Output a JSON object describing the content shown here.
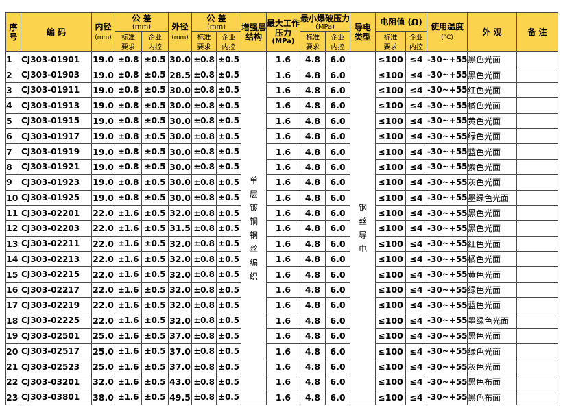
{
  "header": {
    "seq": [
      "序",
      "号"
    ],
    "code": "编 码",
    "inner_dia": "内径",
    "inner_unit": "(mm)",
    "tol1": "公 差",
    "tol1_unit": "(mm)",
    "outer_dia": "外径",
    "outer_unit": "(mm)",
    "tol2": "公 差",
    "tol2_unit": "(mm)",
    "reinf": [
      "增强层",
      "结构"
    ],
    "wp": "最大工作",
    "wp2": "压力",
    "wp_unit": "(MPa)",
    "burst": "最小爆破压力",
    "burst_unit": "(MPa)",
    "conduct": [
      "导电",
      "类型"
    ],
    "resist": "电阻值 (Ω)",
    "temp": "使用温度",
    "temp_unit": "(°C)",
    "look": "外 观",
    "note": "备 注",
    "std": [
      "标准",
      "要求"
    ],
    "ent": [
      "企业",
      "内控"
    ]
  },
  "merged": {
    "reinforcement": [
      "单",
      "层",
      "镀",
      "铜",
      "钢",
      "丝",
      "编",
      "织"
    ],
    "conduct_type": [
      "钢",
      "丝",
      "导",
      "电"
    ]
  },
  "rows": [
    {
      "seq": "1",
      "code": "CJ303-01901",
      "id": "19.0",
      "tol_std": "±0.8",
      "tol_ent": "±0.5",
      "od": "30.0",
      "od_std": "±0.8",
      "od_ent": "±0.5",
      "wp": "1.6",
      "burst_std": "4.8",
      "burst_ent": "6.0",
      "res_std": "≤100",
      "res_ent": "≤4",
      "temp": "-30~+55",
      "look": "黑色光面"
    },
    {
      "seq": "2",
      "code": "CJ303-01903",
      "id": "19.0",
      "tol_std": "±0.8",
      "tol_ent": "±0.5",
      "od": "28.5",
      "od_std": "±0.8",
      "od_ent": "±0.5",
      "wp": "1.6",
      "burst_std": "4.8",
      "burst_ent": "6.0",
      "res_std": "≤100",
      "res_ent": "≤4",
      "temp": "-30~+55",
      "look": "黑色光面"
    },
    {
      "seq": "3",
      "code": "CJ303-01911",
      "id": "19.0",
      "tol_std": "±0.8",
      "tol_ent": "±0.5",
      "od": "30.0",
      "od_std": "±0.8",
      "od_ent": "±0.5",
      "wp": "1.6",
      "burst_std": "4.8",
      "burst_ent": "6.0",
      "res_std": "≤100",
      "res_ent": "≤4",
      "temp": "-30~+55",
      "look": "红色光面"
    },
    {
      "seq": "4",
      "code": "CJ303-01913",
      "id": "19.0",
      "tol_std": "±0.8",
      "tol_ent": "±0.5",
      "od": "30.0",
      "od_std": "±0.8",
      "od_ent": "±0.5",
      "wp": "1.6",
      "burst_std": "4.8",
      "burst_ent": "6.0",
      "res_std": "≤100",
      "res_ent": "≤4",
      "temp": "-30~+55",
      "look": "橘色光面"
    },
    {
      "seq": "5",
      "code": "CJ303-01915",
      "id": "19.0",
      "tol_std": "±0.8",
      "tol_ent": "±0.5",
      "od": "30.0",
      "od_std": "±0.8",
      "od_ent": "±0.5",
      "wp": "1.6",
      "burst_std": "4.8",
      "burst_ent": "6.0",
      "res_std": "≤100",
      "res_ent": "≤4",
      "temp": "-30~+55",
      "look": "黄色光面"
    },
    {
      "seq": "6",
      "code": "CJ303-01917",
      "id": "19.0",
      "tol_std": "±0.8",
      "tol_ent": "±0.5",
      "od": "30.0",
      "od_std": "±0.8",
      "od_ent": "±0.5",
      "wp": "1.6",
      "burst_std": "4.8",
      "burst_ent": "6.0",
      "res_std": "≤100",
      "res_ent": "≤4",
      "temp": "-30~+55",
      "look": "绿色光面"
    },
    {
      "seq": "7",
      "code": "CJ303-01919",
      "id": "19.0",
      "tol_std": "±0.8",
      "tol_ent": "±0.5",
      "od": "30.0",
      "od_std": "±0.8",
      "od_ent": "±0.5",
      "wp": "1.6",
      "burst_std": "4.8",
      "burst_ent": "6.0",
      "res_std": "≤100",
      "res_ent": "≤4",
      "temp": "-30~+55",
      "look": "蓝色光面"
    },
    {
      "seq": "8",
      "code": "CJ303-01921",
      "id": "19.0",
      "tol_std": "±0.8",
      "tol_ent": "±0.5",
      "od": "30.0",
      "od_std": "±0.8",
      "od_ent": "±0.5",
      "wp": "1.6",
      "burst_std": "4.8",
      "burst_ent": "6.0",
      "res_std": "≤100",
      "res_ent": "≤4",
      "temp": "-30~+55",
      "look": "紫色光面"
    },
    {
      "seq": "9",
      "code": "CJ303-01923",
      "id": "19.0",
      "tol_std": "±0.8",
      "tol_ent": "±0.5",
      "od": "30.0",
      "od_std": "±0.8",
      "od_ent": "±0.5",
      "wp": "1.6",
      "burst_std": "4.8",
      "burst_ent": "6.0",
      "res_std": "≤100",
      "res_ent": "≤4",
      "temp": "-30~+55",
      "look": "灰色光面"
    },
    {
      "seq": "10",
      "code": "CJ303-01925",
      "id": "19.0",
      "tol_std": "±0.8",
      "tol_ent": "±0.5",
      "od": "30.0",
      "od_std": "±0.8",
      "od_ent": "±0.5",
      "wp": "1.6",
      "burst_std": "4.8",
      "burst_ent": "6.0",
      "res_std": "≤100",
      "res_ent": "≤4",
      "temp": "-30~+55",
      "look": "墨绿色光面"
    },
    {
      "seq": "11",
      "code": "CJ303-02201",
      "id": "22.0",
      "tol_std": "±1.6",
      "tol_ent": "±0.5",
      "od": "32.0",
      "od_std": "±0.8",
      "od_ent": "±0.5",
      "wp": "1.6",
      "burst_std": "4.8",
      "burst_ent": "6.0",
      "res_std": "≤100",
      "res_ent": "≤4",
      "temp": "-30~+55",
      "look": "黑色光面"
    },
    {
      "seq": "12",
      "code": "CJ303-02203",
      "id": "22.0",
      "tol_std": "±1.6",
      "tol_ent": "±0.5",
      "od": "31.5",
      "od_std": "±0.8",
      "od_ent": "±0.5",
      "wp": "1.6",
      "burst_std": "4.8",
      "burst_ent": "6.0",
      "res_std": "≤100",
      "res_ent": "≤4",
      "temp": "-30~+55",
      "look": "黑色光面"
    },
    {
      "seq": "13",
      "code": "CJ303-02211",
      "id": "22.0",
      "tol_std": "±1.6",
      "tol_ent": "±0.5",
      "od": "32.0",
      "od_std": "±0.8",
      "od_ent": "±0.5",
      "wp": "1.6",
      "burst_std": "4.8",
      "burst_ent": "6.0",
      "res_std": "≤100",
      "res_ent": "≤4",
      "temp": "-30~+55",
      "look": "红色光面"
    },
    {
      "seq": "14",
      "code": "CJ303-02213",
      "id": "22.0",
      "tol_std": "±1.6",
      "tol_ent": "±0.5",
      "od": "32.0",
      "od_std": "±0.8",
      "od_ent": "±0.5",
      "wp": "1.6",
      "burst_std": "4.8",
      "burst_ent": "6.0",
      "res_std": "≤100",
      "res_ent": "≤4",
      "temp": "-30~+55",
      "look": "橘色光面"
    },
    {
      "seq": "15",
      "code": "CJ303-02215",
      "id": "22.0",
      "tol_std": "±1.6",
      "tol_ent": "±0.5",
      "od": "32.0",
      "od_std": "±0.8",
      "od_ent": "±0.5",
      "wp": "1.6",
      "burst_std": "4.8",
      "burst_ent": "6.0",
      "res_std": "≤100",
      "res_ent": "≤4",
      "temp": "-30~+55",
      "look": "黄色光面"
    },
    {
      "seq": "16",
      "code": "CJ303-02217",
      "id": "22.0",
      "tol_std": "±1.6",
      "tol_ent": "±0.5",
      "od": "32.0",
      "od_std": "±0.8",
      "od_ent": "±0.5",
      "wp": "1.6",
      "burst_std": "4.8",
      "burst_ent": "6.0",
      "res_std": "≤100",
      "res_ent": "≤4",
      "temp": "-30~+55",
      "look": "绿色光面"
    },
    {
      "seq": "17",
      "code": "CJ303-02219",
      "id": "22.0",
      "tol_std": "±1.6",
      "tol_ent": "±0.5",
      "od": "32.0",
      "od_std": "±0.8",
      "od_ent": "±0.5",
      "wp": "1.6",
      "burst_std": "4.8",
      "burst_ent": "6.0",
      "res_std": "≤100",
      "res_ent": "≤4",
      "temp": "-30~+55",
      "look": "蓝色光面"
    },
    {
      "seq": "18",
      "code": "CJ303-02225",
      "id": "22.0",
      "tol_std": "±1.6",
      "tol_ent": "±0.5",
      "od": "32.0",
      "od_std": "±0.8",
      "od_ent": "±0.5",
      "wp": "1.6",
      "burst_std": "4.8",
      "burst_ent": "6.0",
      "res_std": "≤100",
      "res_ent": "≤4",
      "temp": "-30~+55",
      "look": "墨绿色光面"
    },
    {
      "seq": "19",
      "code": "CJ303-02501",
      "id": "25.0",
      "tol_std": "±1.6",
      "tol_ent": "±0.5",
      "od": "37.0",
      "od_std": "±0.8",
      "od_ent": "±0.5",
      "wp": "1.6",
      "burst_std": "4.8",
      "burst_ent": "6.0",
      "res_std": "≤100",
      "res_ent": "≤4",
      "temp": "-30~+55",
      "look": "黑色光面"
    },
    {
      "seq": "20",
      "code": "CJ303-02517",
      "id": "25.0",
      "tol_std": "±1.6",
      "tol_ent": "±0.5",
      "od": "37.0",
      "od_std": "±0.8",
      "od_ent": "±0.5",
      "wp": "1.6",
      "burst_std": "4.8",
      "burst_ent": "6.0",
      "res_std": "≤100",
      "res_ent": "≤4",
      "temp": "-30~+55",
      "look": "绿色光面"
    },
    {
      "seq": "21",
      "code": "CJ303-02523",
      "id": "25.0",
      "tol_std": "±1.6",
      "tol_ent": "±0.5",
      "od": "37.0",
      "od_std": "±0.8",
      "od_ent": "±0.5",
      "wp": "1.6",
      "burst_std": "4.8",
      "burst_ent": "6.0",
      "res_std": "≤100",
      "res_ent": "≤4",
      "temp": "-30~+55",
      "look": "灰色光面"
    },
    {
      "seq": "22",
      "code": "CJ303-03201",
      "id": "32.0",
      "tol_std": "±1.6",
      "tol_ent": "±0.5",
      "od": "43.0",
      "od_std": "±0.8",
      "od_ent": "±0.5",
      "wp": "1.6",
      "burst_std": "4.8",
      "burst_ent": "6.0",
      "res_std": "≤100",
      "res_ent": "≤4",
      "temp": "-30~+55",
      "look": "黑色布面"
    },
    {
      "seq": "23",
      "code": "CJ303-03801",
      "id": "38.0",
      "tol_std": "±1.6",
      "tol_ent": "±0.5",
      "od": "49.5",
      "od_std": "±0.8",
      "od_ent": "±0.5",
      "wp": "1.6",
      "burst_std": "4.8",
      "burst_ent": "6.0",
      "res_std": "≤100",
      "res_ent": "≤4",
      "temp": "-30~+55",
      "look": "黑色布面"
    }
  ]
}
